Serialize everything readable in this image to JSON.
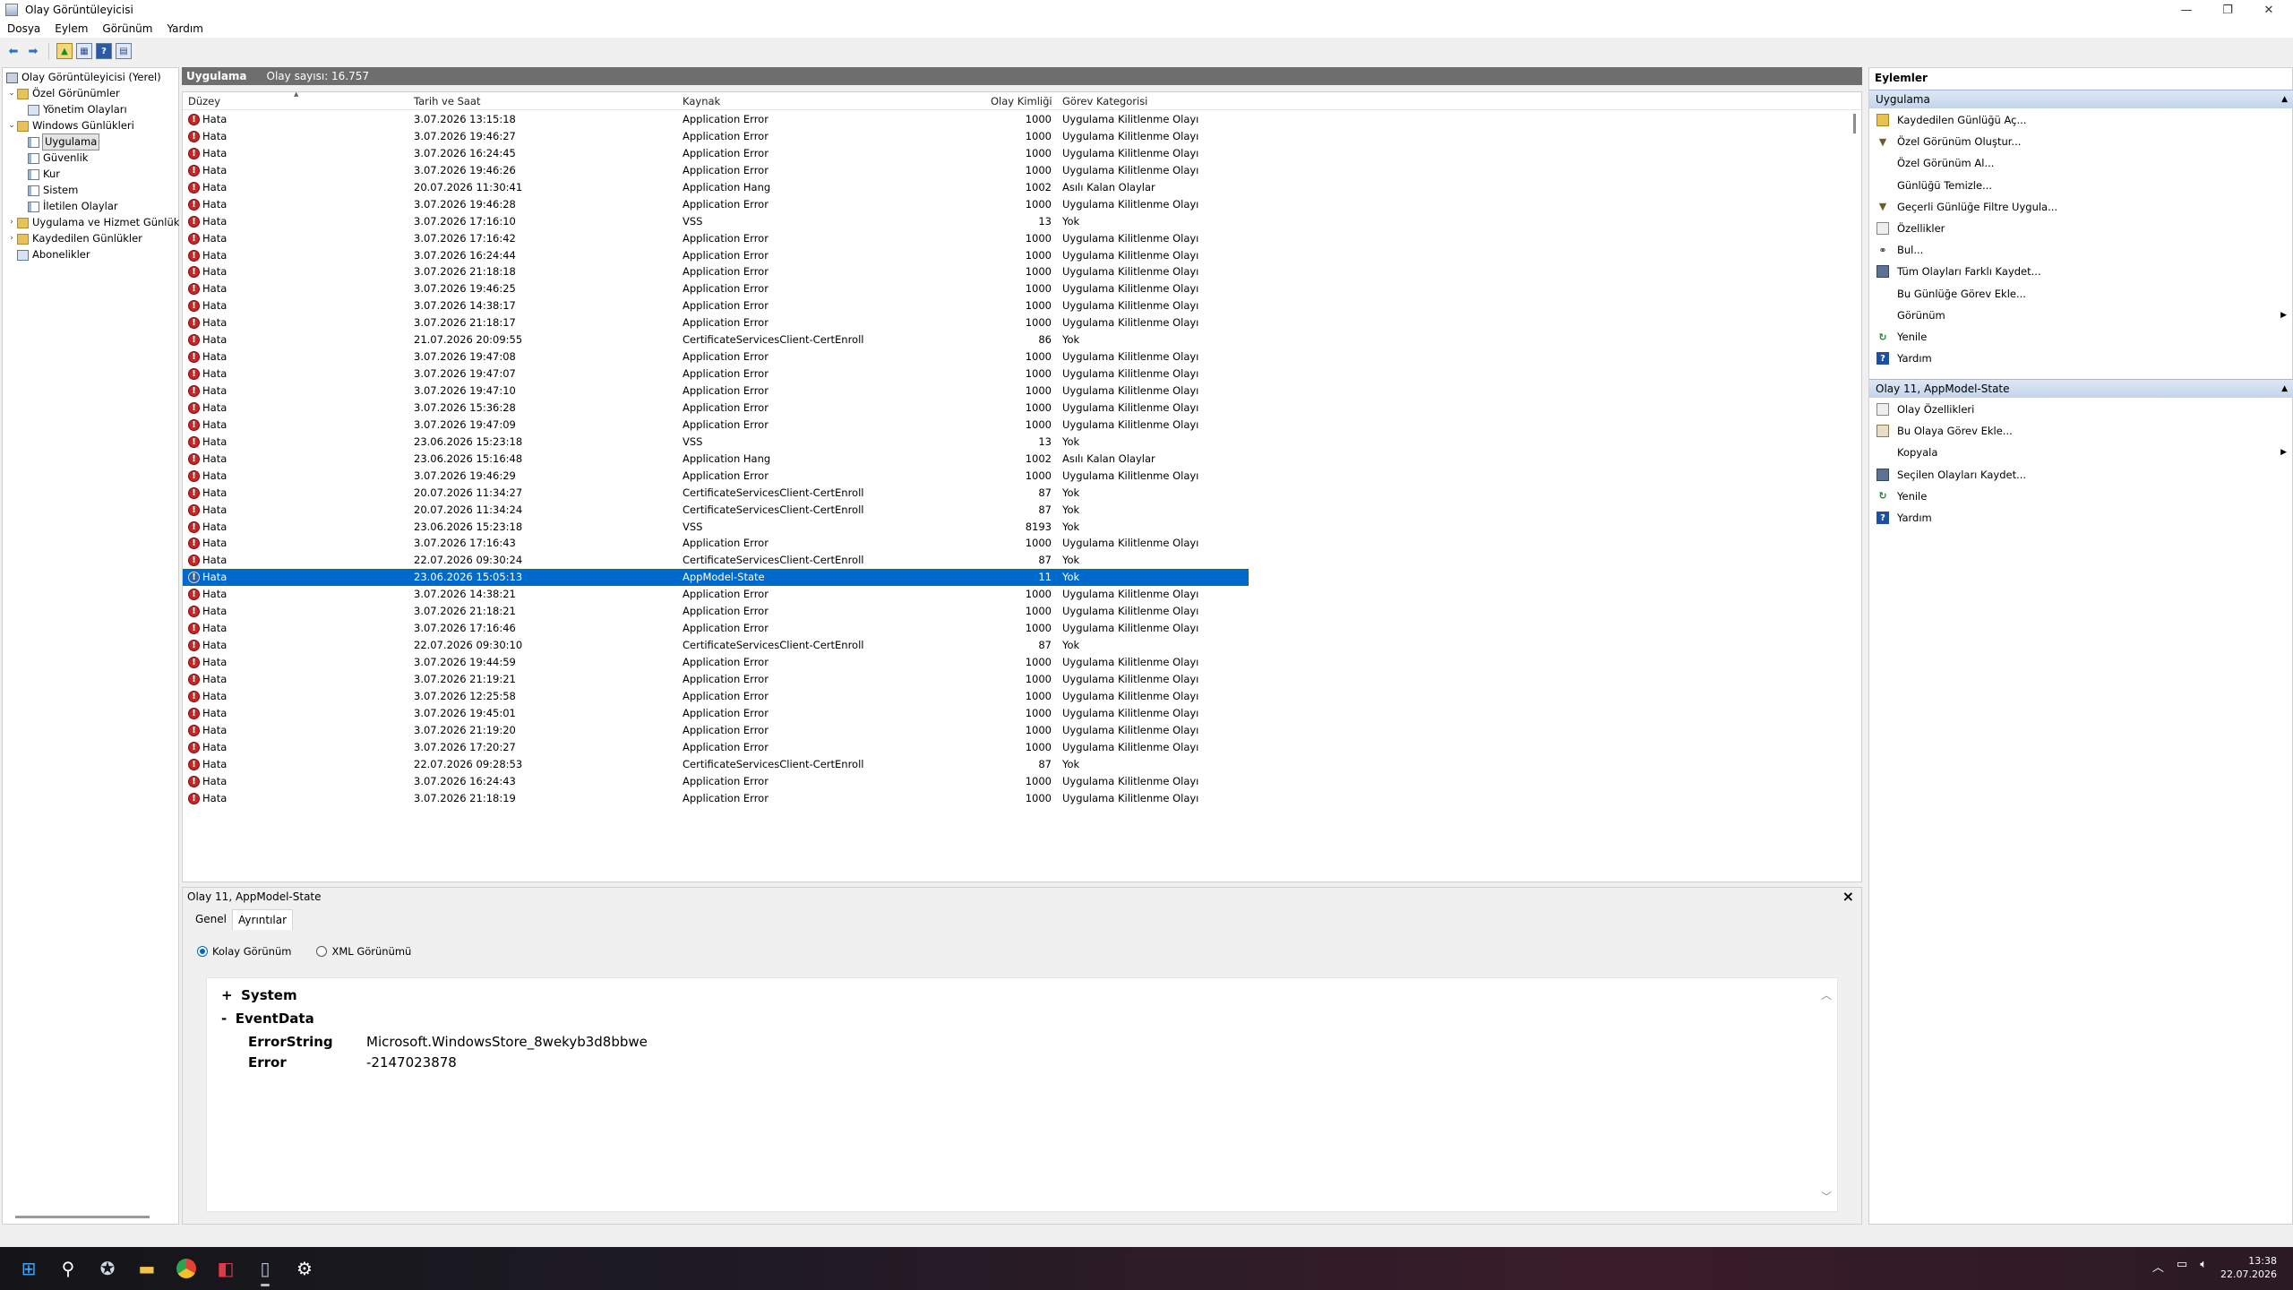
{
  "window": {
    "title": "Olay Görüntüleyicisi"
  },
  "menu": [
    "Dosya",
    "Eylem",
    "Görünüm",
    "Yardım"
  ],
  "nav": {
    "root": "Olay Görüntüleyicisi (Yerel)",
    "custom_views": "Özel Görünümler",
    "admin_events": "Yönetim Olayları",
    "windows_logs": "Windows Günlükleri",
    "app": "Uygulama",
    "security": "Güvenlik",
    "setup": "Kur",
    "system": "Sistem",
    "forwarded": "İletilen Olaylar",
    "app_services": "Uygulama ve Hizmet Günlük",
    "saved_logs": "Kaydedilen Günlükler",
    "subscriptions": "Abonelikler"
  },
  "log": {
    "name": "Uygulama",
    "count_label": "Olay sayısı: 16.757"
  },
  "columns": [
    "Düzey",
    "Tarih ve Saat",
    "Kaynak",
    "Olay Kimliği",
    "Görev Kategorisi"
  ],
  "rows": [
    [
      "Hata",
      "3.07.2026 13:15:18",
      "Application Error",
      "1000",
      "Uygulama Kilitlenme Olayı"
    ],
    [
      "Hata",
      "3.07.2026 19:46:27",
      "Application Error",
      "1000",
      "Uygulama Kilitlenme Olayı"
    ],
    [
      "Hata",
      "3.07.2026 16:24:45",
      "Application Error",
      "1000",
      "Uygulama Kilitlenme Olayı"
    ],
    [
      "Hata",
      "3.07.2026 19:46:26",
      "Application Error",
      "1000",
      "Uygulama Kilitlenme Olayı"
    ],
    [
      "Hata",
      "20.07.2026 11:30:41",
      "Application Hang",
      "1002",
      "Asılı Kalan Olaylar"
    ],
    [
      "Hata",
      "3.07.2026 19:46:28",
      "Application Error",
      "1000",
      "Uygulama Kilitlenme Olayı"
    ],
    [
      "Hata",
      "3.07.2026 17:16:10",
      "VSS",
      "13",
      "Yok"
    ],
    [
      "Hata",
      "3.07.2026 17:16:42",
      "Application Error",
      "1000",
      "Uygulama Kilitlenme Olayı"
    ],
    [
      "Hata",
      "3.07.2026 16:24:44",
      "Application Error",
      "1000",
      "Uygulama Kilitlenme Olayı"
    ],
    [
      "Hata",
      "3.07.2026 21:18:18",
      "Application Error",
      "1000",
      "Uygulama Kilitlenme Olayı"
    ],
    [
      "Hata",
      "3.07.2026 19:46:25",
      "Application Error",
      "1000",
      "Uygulama Kilitlenme Olayı"
    ],
    [
      "Hata",
      "3.07.2026 14:38:17",
      "Application Error",
      "1000",
      "Uygulama Kilitlenme Olayı"
    ],
    [
      "Hata",
      "3.07.2026 21:18:17",
      "Application Error",
      "1000",
      "Uygulama Kilitlenme Olayı"
    ],
    [
      "Hata",
      "21.07.2026 20:09:55",
      "CertificateServicesClient-CertEnroll",
      "86",
      "Yok"
    ],
    [
      "Hata",
      "3.07.2026 19:47:08",
      "Application Error",
      "1000",
      "Uygulama Kilitlenme Olayı"
    ],
    [
      "Hata",
      "3.07.2026 19:47:07",
      "Application Error",
      "1000",
      "Uygulama Kilitlenme Olayı"
    ],
    [
      "Hata",
      "3.07.2026 19:47:10",
      "Application Error",
      "1000",
      "Uygulama Kilitlenme Olayı"
    ],
    [
      "Hata",
      "3.07.2026 15:36:28",
      "Application Error",
      "1000",
      "Uygulama Kilitlenme Olayı"
    ],
    [
      "Hata",
      "3.07.2026 19:47:09",
      "Application Error",
      "1000",
      "Uygulama Kilitlenme Olayı"
    ],
    [
      "Hata",
      "23.06.2026 15:23:18",
      "VSS",
      "13",
      "Yok"
    ],
    [
      "Hata",
      "23.06.2026 15:16:48",
      "Application Hang",
      "1002",
      "Asılı Kalan Olaylar"
    ],
    [
      "Hata",
      "3.07.2026 19:46:29",
      "Application Error",
      "1000",
      "Uygulama Kilitlenme Olayı"
    ],
    [
      "Hata",
      "20.07.2026 11:34:27",
      "CertificateServicesClient-CertEnroll",
      "87",
      "Yok"
    ],
    [
      "Hata",
      "20.07.2026 11:34:24",
      "CertificateServicesClient-CertEnroll",
      "87",
      "Yok"
    ],
    [
      "Hata",
      "23.06.2026 15:23:18",
      "VSS",
      "8193",
      "Yok"
    ],
    [
      "Hata",
      "3.07.2026 17:16:43",
      "Application Error",
      "1000",
      "Uygulama Kilitlenme Olayı"
    ],
    [
      "Hata",
      "22.07.2026 09:30:24",
      "CertificateServicesClient-CertEnroll",
      "87",
      "Yok"
    ],
    [
      "Hata",
      "23.06.2026 15:05:13",
      "AppModel-State",
      "11",
      "Yok"
    ],
    [
      "Hata",
      "3.07.2026 14:38:21",
      "Application Error",
      "1000",
      "Uygulama Kilitlenme Olayı"
    ],
    [
      "Hata",
      "3.07.2026 21:18:21",
      "Application Error",
      "1000",
      "Uygulama Kilitlenme Olayı"
    ],
    [
      "Hata",
      "3.07.2026 17:16:46",
      "Application Error",
      "1000",
      "Uygulama Kilitlenme Olayı"
    ],
    [
      "Hata",
      "22.07.2026 09:30:10",
      "CertificateServicesClient-CertEnroll",
      "87",
      "Yok"
    ],
    [
      "Hata",
      "3.07.2026 19:44:59",
      "Application Error",
      "1000",
      "Uygulama Kilitlenme Olayı"
    ],
    [
      "Hata",
      "3.07.2026 21:19:21",
      "Application Error",
      "1000",
      "Uygulama Kilitlenme Olayı"
    ],
    [
      "Hata",
      "3.07.2026 12:25:58",
      "Application Error",
      "1000",
      "Uygulama Kilitlenme Olayı"
    ],
    [
      "Hata",
      "3.07.2026 19:45:01",
      "Application Error",
      "1000",
      "Uygulama Kilitlenme Olayı"
    ],
    [
      "Hata",
      "3.07.2026 21:19:20",
      "Application Error",
      "1000",
      "Uygulama Kilitlenme Olayı"
    ],
    [
      "Hata",
      "3.07.2026 17:20:27",
      "Application Error",
      "1000",
      "Uygulama Kilitlenme Olayı"
    ],
    [
      "Hata",
      "22.07.2026 09:28:53",
      "CertificateServicesClient-CertEnroll",
      "87",
      "Yok"
    ],
    [
      "Hata",
      "3.07.2026 16:24:43",
      "Application Error",
      "1000",
      "Uygulama Kilitlenme Olayı"
    ],
    [
      "Hata",
      "3.07.2026 21:18:19",
      "Application Error",
      "1000",
      "Uygulama Kilitlenme Olayı"
    ]
  ],
  "selected_row": 27,
  "detail": {
    "title": "Olay 11, AppModel-State",
    "tab_general": "Genel",
    "tab_details": "Ayrıntılar",
    "radio_friendly": "Kolay Görünüm",
    "radio_xml": "XML Görünümü",
    "system_toggle": "+",
    "system_label": "System",
    "eventdata_toggle": "-",
    "eventdata_label": "EventData",
    "field1_name": "ErrorString",
    "field1_value": "Microsoft.WindowsStore_8wekyb3d8bbwe",
    "field2_name": "Error",
    "field2_value": "-2147023878"
  },
  "actions": {
    "header": "Eylemler",
    "group1": "Uygulama",
    "group1_items": [
      "Kaydedilen Günlüğü Aç...",
      "Özel Görünüm Oluştur...",
      "Özel Görünüm Al...",
      "Günlüğü Temizle...",
      "Geçerli Günlüğe Filtre Uygula...",
      "Özellikler",
      "Bul...",
      "Tüm Olayları Farklı Kaydet...",
      "Bu Günlüğe Görev Ekle...",
      "Görünüm",
      "Yenile",
      "Yardım"
    ],
    "group2": "Olay 11, AppModel-State",
    "group2_items": [
      "Olay Özellikleri",
      "Bu Olaya Görev Ekle...",
      "Kopyala",
      "Seçilen Olayları Kaydet...",
      "Yenile",
      "Yardım"
    ]
  },
  "taskbar": {
    "time": "13:38",
    "date": "22.07.2026"
  }
}
